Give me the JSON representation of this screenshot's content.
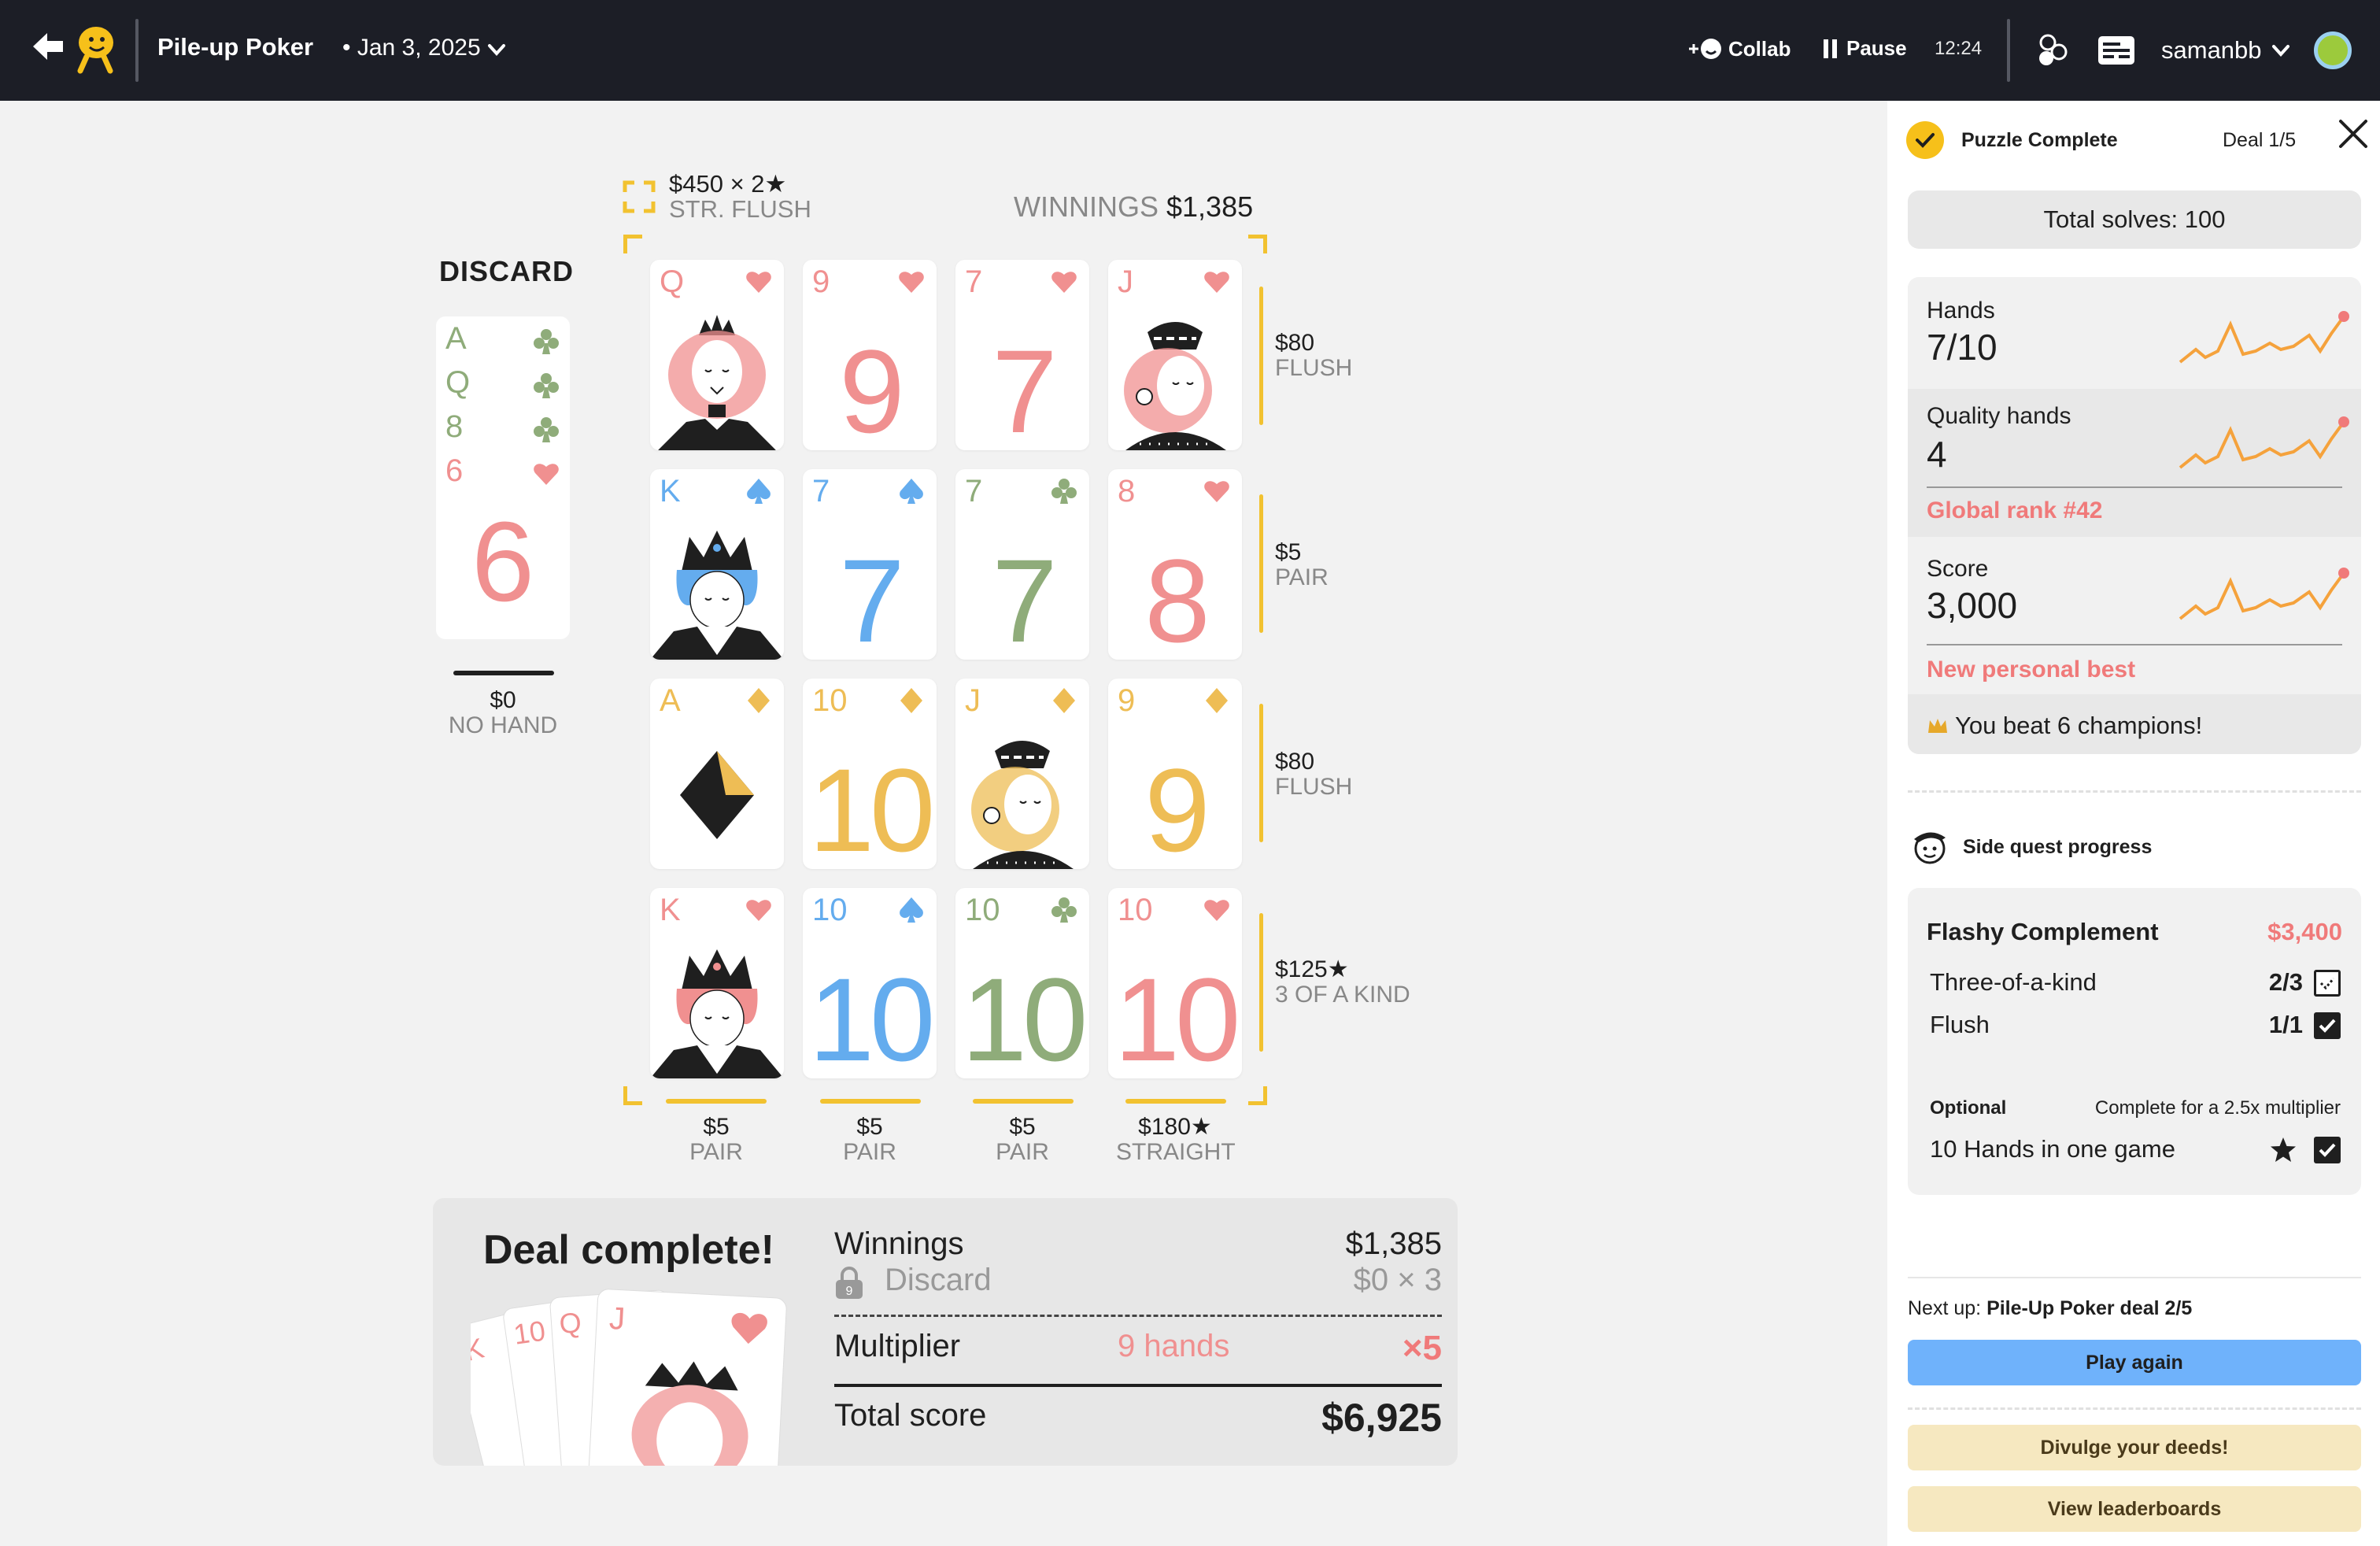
{
  "topbar": {
    "title": "Pile-up Poker",
    "date": "• Jan 3, 2025",
    "collab_label": "Collab",
    "pause_label": "Pause",
    "timer": "12:24",
    "username": "samanbb"
  },
  "board": {
    "top_hand_value": "$450 × 2★",
    "top_hand_name": "STR. FLUSH",
    "winnings_label": "WINNINGS",
    "winnings_value": "$1,385",
    "discard": {
      "label": "DISCARD",
      "cards": [
        {
          "rank": "A",
          "suit": "clubs"
        },
        {
          "rank": "Q",
          "suit": "clubs"
        },
        {
          "rank": "8",
          "suit": "clubs"
        },
        {
          "rank": "6",
          "suit": "hearts"
        }
      ],
      "value": "$0",
      "hand": "NO HAND"
    },
    "grid": [
      [
        {
          "rank": "Q",
          "suit": "hearts",
          "face": true
        },
        {
          "rank": "9",
          "suit": "hearts"
        },
        {
          "rank": "7",
          "suit": "hearts"
        },
        {
          "rank": "J",
          "suit": "hearts",
          "face": true
        }
      ],
      [
        {
          "rank": "K",
          "suit": "spades",
          "face": true
        },
        {
          "rank": "7",
          "suit": "spades"
        },
        {
          "rank": "7",
          "suit": "clubs"
        },
        {
          "rank": "8",
          "suit": "hearts"
        }
      ],
      [
        {
          "rank": "A",
          "suit": "diamonds",
          "face": true
        },
        {
          "rank": "10",
          "suit": "diamonds"
        },
        {
          "rank": "J",
          "suit": "diamonds",
          "face": true
        },
        {
          "rank": "9",
          "suit": "diamonds"
        }
      ],
      [
        {
          "rank": "K",
          "suit": "hearts",
          "face": true
        },
        {
          "rank": "10",
          "suit": "spades"
        },
        {
          "rank": "10",
          "suit": "clubs"
        },
        {
          "rank": "10",
          "suit": "hearts"
        }
      ]
    ],
    "row_scores": [
      {
        "value": "$80",
        "hand": "FLUSH"
      },
      {
        "value": "$5",
        "hand": "PAIR"
      },
      {
        "value": "$80",
        "hand": "FLUSH"
      },
      {
        "value": "$125★",
        "hand": "3 OF A KIND"
      }
    ],
    "col_scores": [
      {
        "value": "$5",
        "hand": "PAIR"
      },
      {
        "value": "$5",
        "hand": "PAIR"
      },
      {
        "value": "$5",
        "hand": "PAIR"
      },
      {
        "value": "$180★",
        "hand": "STRAIGHT"
      }
    ]
  },
  "deal": {
    "title": "Deal complete!",
    "fan_ranks": [
      "K",
      "10",
      "Q",
      "J"
    ],
    "winnings_label": "Winnings",
    "winnings_value": "$1,385",
    "discard_label": "Discard",
    "discard_badge": "9",
    "discard_value": "$0 × 3",
    "multiplier_label": "Multiplier",
    "multiplier_detail": "9 hands",
    "multiplier_value": "×5",
    "total_label": "Total score",
    "total_value": "$6,925"
  },
  "panel": {
    "title": "Puzzle Complete",
    "deal_counter": "Deal 1/5",
    "total_solves": "Total solves: 100",
    "stats": {
      "hands_label": "Hands",
      "hands_value": "7/10",
      "quality_label": "Quality hands",
      "quality_value": "4",
      "global_rank": "Global rank #42",
      "score_label": "Score",
      "score_value": "3,000",
      "personal_best": "New personal best",
      "beat_text": "You beat 6 champions!"
    },
    "side_quest_title": "Side quest progress",
    "quest": {
      "name": "Flashy Complement",
      "prize": "$3,400",
      "items": [
        {
          "label": "Three-of-a-kind",
          "count": "2/3"
        },
        {
          "label": "Flush",
          "count": "1/1"
        }
      ],
      "optional_label": "Optional",
      "optional_desc": "Complete for a 2.5x multiplier",
      "optional_item": "10 Hands in one game"
    },
    "next_up_prefix": "Next up:",
    "next_up_name": "Pile-Up Poker deal 2/5",
    "play_again": "Play again",
    "divulge": "Divulge your deeds!",
    "leaderboards": "View leaderboards"
  },
  "colors": {
    "hearts": "#f09090",
    "spades": "#64acee",
    "clubs": "#8fac7a",
    "diamonds": "#eebd55",
    "accent": "#f2c230",
    "topbar": "#1c1e26"
  }
}
